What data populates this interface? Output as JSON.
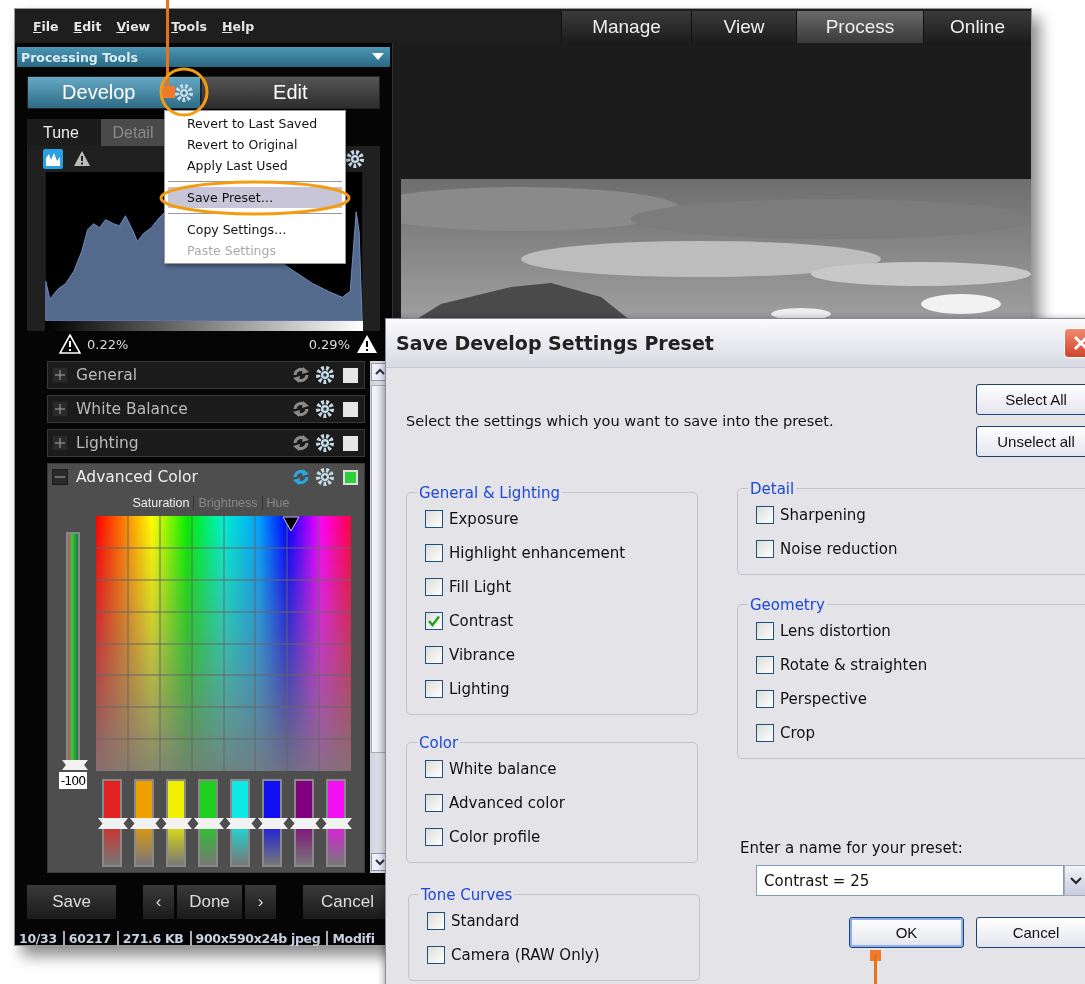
{
  "menu_bar": {
    "items": [
      "File",
      "Edit",
      "View",
      "Tools",
      "Help"
    ]
  },
  "mode_tabs": [
    {
      "label": "Manage",
      "selected": false
    },
    {
      "label": "View",
      "selected": false
    },
    {
      "label": "Process",
      "selected": true
    },
    {
      "label": "Online",
      "selected": false
    }
  ],
  "panel": {
    "title": "Processing Tools",
    "mode_buttons": [
      {
        "label": "Develop",
        "selected": true
      },
      {
        "label": "Edit",
        "selected": false
      }
    ],
    "tabs": [
      {
        "label": "Tune",
        "selected": true
      },
      {
        "label": "Detail",
        "selected": false
      }
    ],
    "clipping": {
      "shadows": "0.22%",
      "highlights": "0.29%"
    },
    "sections": [
      {
        "label": "General",
        "expanded": false,
        "enabled": false
      },
      {
        "label": "White Balance",
        "expanded": false,
        "enabled": false
      },
      {
        "label": "Lighting",
        "expanded": false,
        "enabled": false
      },
      {
        "label": "Advanced Color",
        "expanded": true,
        "enabled": true
      }
    ],
    "color_tabs": [
      {
        "label": "Saturation",
        "selected": true
      },
      {
        "label": "Brightness",
        "selected": false
      },
      {
        "label": "Hue",
        "selected": false
      }
    ],
    "master_slider": {
      "level": 0,
      "value": "-100"
    },
    "channel_sliders": [
      {
        "color": "#e02424",
        "level": 0.5
      },
      {
        "color": "#f0a000",
        "level": 0.5
      },
      {
        "color": "#f0f000",
        "level": 0.5
      },
      {
        "color": "#20d020",
        "level": 0.5
      },
      {
        "color": "#10e8e8",
        "level": 0.5
      },
      {
        "color": "#1010f0",
        "level": 0.5
      },
      {
        "color": "#800080",
        "level": 0.5
      },
      {
        "color": "#f010f0",
        "level": 0.5
      }
    ],
    "footer": {
      "save": "Save",
      "prev": "‹",
      "done": "Done",
      "next": "›",
      "cancel": "Cancel"
    },
    "status_bar": [
      "10/33",
      "60217",
      "271.6 KB",
      "900x590x24b jpeg",
      "Modifi"
    ]
  },
  "context_menu": {
    "groups": [
      [
        {
          "label": "Revert to Last Saved",
          "selected": false,
          "disabled": false
        },
        {
          "label": "Revert to Original",
          "selected": false,
          "disabled": false
        },
        {
          "label": "Apply Last Used",
          "selected": false,
          "disabled": false
        }
      ],
      [
        {
          "label": "Save Preset…",
          "selected": true,
          "disabled": false
        }
      ],
      [
        {
          "label": "Copy Settings…",
          "selected": false,
          "disabled": false
        },
        {
          "label": "Paste Settings",
          "selected": false,
          "disabled": true
        }
      ]
    ]
  },
  "dialog": {
    "title": "Save Develop Settings Preset",
    "instruction": "Select the settings which you want to save into the preset.",
    "select_all": "Select All",
    "unselect_all": "Unselect all",
    "left_groups": [
      {
        "title": "General & Lighting",
        "items": [
          {
            "label": "Exposure",
            "checked": false
          },
          {
            "label": "Highlight enhancement",
            "checked": false
          },
          {
            "label": "Fill Light",
            "checked": false
          },
          {
            "label": "Contrast",
            "checked": true
          },
          {
            "label": "Vibrance",
            "checked": false
          },
          {
            "label": "Lighting",
            "checked": false
          }
        ]
      },
      {
        "title": "Color",
        "items": [
          {
            "label": "White balance",
            "checked": false
          },
          {
            "label": "Advanced color",
            "checked": false
          },
          {
            "label": "Color profile",
            "checked": false
          }
        ]
      },
      {
        "title": "Tone Curves",
        "items": [
          {
            "label": "Standard",
            "checked": false
          },
          {
            "label": "Camera (RAW Only)",
            "checked": false
          }
        ]
      }
    ],
    "right_groups": [
      {
        "title": "Detail",
        "items": [
          {
            "label": "Sharpening",
            "checked": false
          },
          {
            "label": "Noise reduction",
            "checked": false
          }
        ]
      },
      {
        "title": "Geometry",
        "items": [
          {
            "label": "Lens distortion",
            "checked": false
          },
          {
            "label": "Rotate & straighten",
            "checked": false
          },
          {
            "label": "Perspective",
            "checked": false
          },
          {
            "label": "Crop",
            "checked": false
          }
        ]
      }
    ],
    "name_label": "Enter a name for your preset:",
    "name_value": "Contrast = 25",
    "ok": "OK",
    "cancel": "Cancel"
  }
}
